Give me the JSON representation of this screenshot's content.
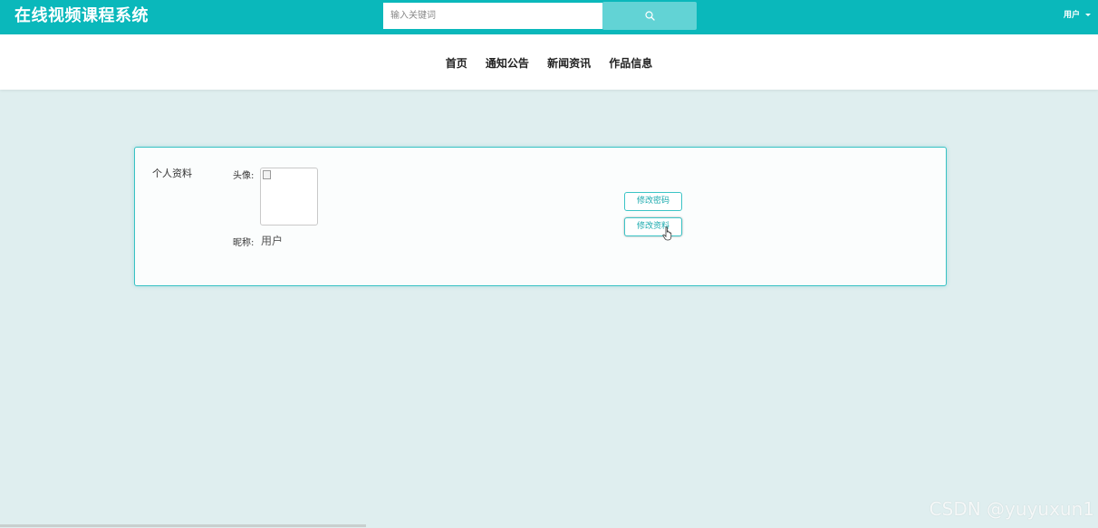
{
  "header": {
    "site_title": "在线视频课程系统",
    "search": {
      "placeholder": "输入关键词",
      "value": ""
    },
    "user_menu_label": "用户"
  },
  "nav": {
    "items": [
      "首页",
      "通知公告",
      "新闻资讯",
      "作品信息"
    ]
  },
  "profile": {
    "heading": "个人资料",
    "avatar_label": "头像:",
    "nickname_label": "昵称:",
    "nickname_value": "用户",
    "change_password_label": "修改密码",
    "edit_profile_label": "修改资料"
  },
  "watermark": "CSDN @yuyuxun1",
  "icons": {
    "search": "search-icon",
    "user_caret": "chevron-down-icon",
    "avatar": "broken-image-icon",
    "cursor": "hand-pointer-icon"
  },
  "colors": {
    "header_bg": "#0ab8bb",
    "search_button_bg": "#62d3d5",
    "page_bg": "#dfeeef",
    "accent_border": "#38c2c4",
    "button_text": "#19a9ad"
  }
}
